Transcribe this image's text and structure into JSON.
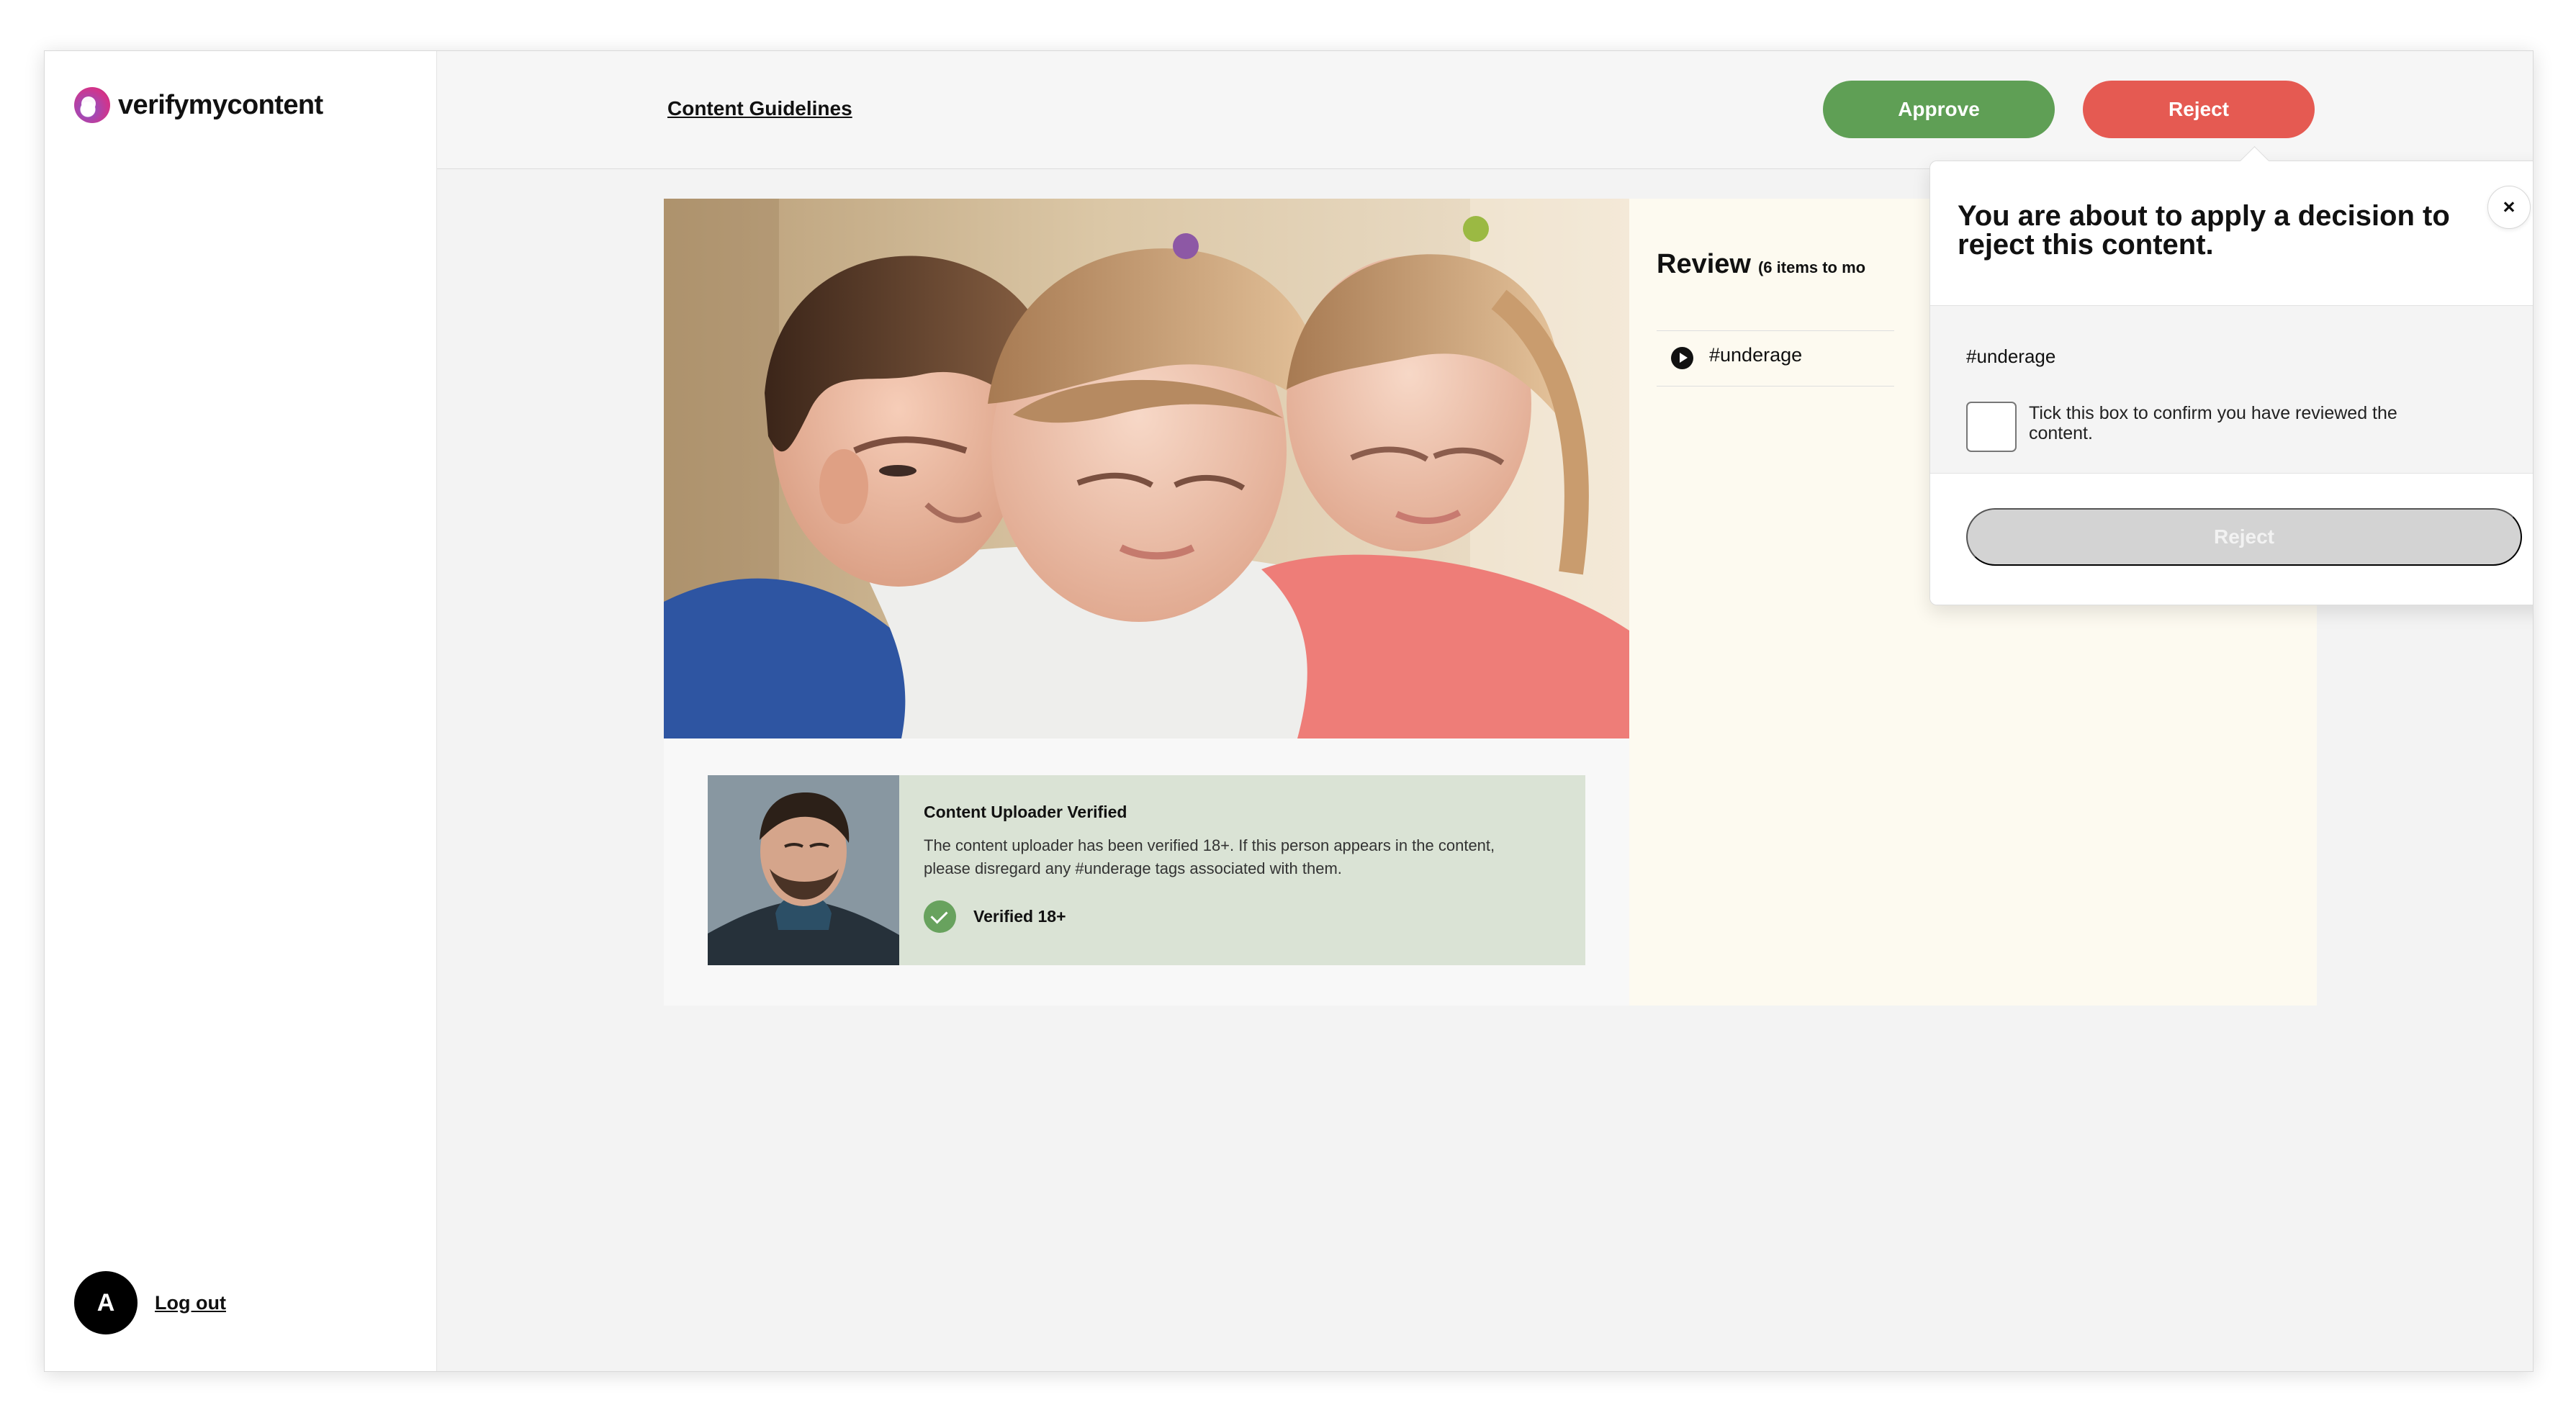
{
  "app": {
    "logo": "verifymycontent"
  },
  "sidebar": {
    "avatar_initial": "A",
    "logout": "Log out"
  },
  "header": {
    "guidelines": "Content Guidelines",
    "approve": "Approve",
    "reject": "Reject"
  },
  "content": {
    "uploader": {
      "title": "Content Uploader Verified",
      "body": "The content uploader has been verified 18+. If this person appears in the content, please disregard any #underage tags associated with them.",
      "status": "Verified 18+"
    }
  },
  "review": {
    "title": "Review",
    "subtitle": "(6 items to mo",
    "item": "#underage"
  },
  "modal": {
    "title": "You are about to apply a decision to reject this content.",
    "tag": "#underage",
    "confirm": "Tick this box to confirm you have reviewed the content.",
    "close": "×",
    "button": "Reject"
  },
  "colors": {
    "approve": "#5f9f55",
    "reject": "#e55a52",
    "verified": "#68a25e",
    "review_background": "#fdfaf0",
    "disabled_button": "#d3d3d3"
  },
  "icons": {
    "logo": "brand-ring-icon",
    "close": "close-icon",
    "play": "play-icon",
    "verified": "check-circle-icon"
  }
}
